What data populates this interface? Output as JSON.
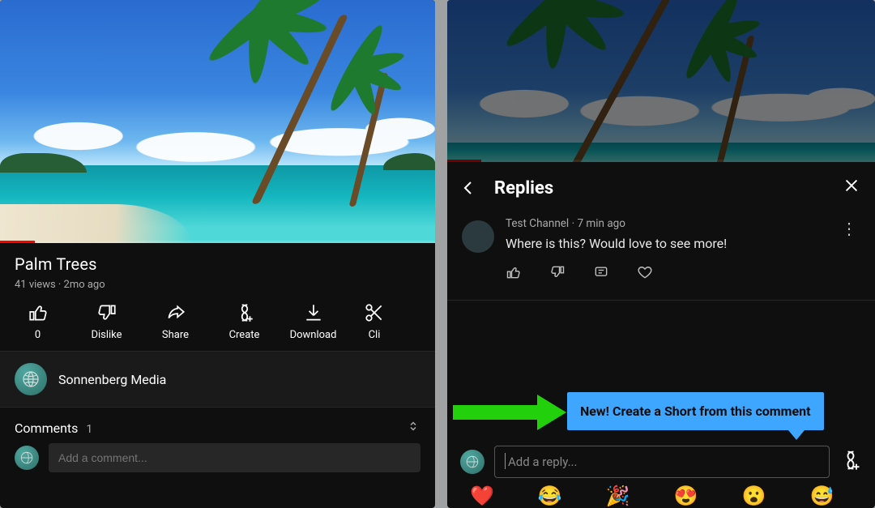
{
  "left": {
    "title": "Palm Trees",
    "stats": "41 views · 2mo ago",
    "actions": {
      "like": {
        "label": "0"
      },
      "dislike": {
        "label": "Dislike"
      },
      "share": {
        "label": "Share"
      },
      "create": {
        "label": "Create"
      },
      "download": {
        "label": "Download"
      },
      "clip": {
        "label": "Cli"
      }
    },
    "channel": {
      "name": "Sonnenberg Media"
    },
    "comments_label": "Comments",
    "comments_count": "1",
    "add_comment_placeholder": "Add a comment..."
  },
  "right": {
    "header": "Replies",
    "comment": {
      "author": "Test Channel",
      "time": "7 min ago",
      "text": "Where is this? Would love to see more!"
    },
    "tooltip": "New! Create a Short from this comment",
    "reply_placeholder": "Add a reply...",
    "emojis": [
      "❤️",
      "😂",
      "🎉",
      "😍",
      "😮",
      "😅"
    ]
  },
  "colors": {
    "accent_red": "#ff0000",
    "tooltip_blue": "#3ea6ff",
    "arrow_green": "#22d10b"
  }
}
